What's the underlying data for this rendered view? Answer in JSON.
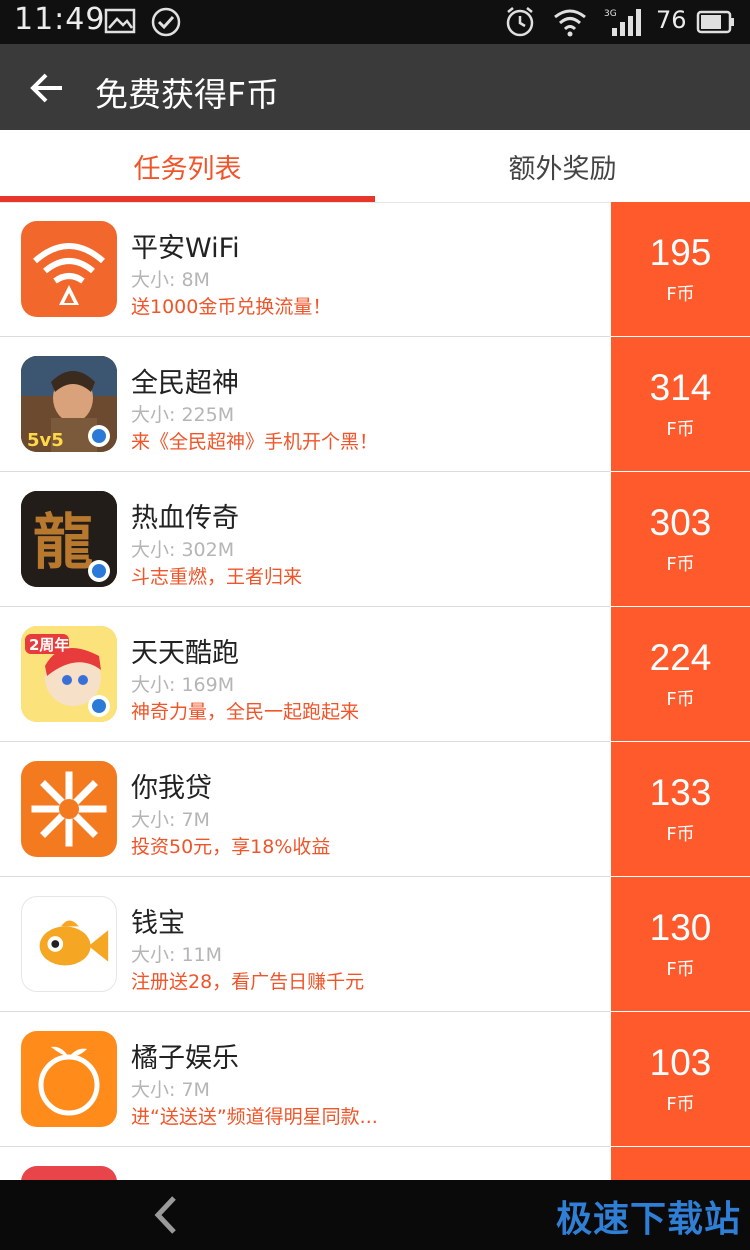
{
  "status_bar": {
    "time": "11:49",
    "battery_level": "76",
    "icons": [
      "image-icon",
      "check-circle-icon",
      "alarm-icon",
      "wifi-icon",
      "signal-3g-icon",
      "battery-icon"
    ]
  },
  "app_bar": {
    "title": "免费获得F币"
  },
  "tabs": [
    {
      "label": "任务列表",
      "active": true
    },
    {
      "label": "额外奖励",
      "active": false
    }
  ],
  "tasks": [
    {
      "name": "平安WiFi",
      "size": "大小: 8M",
      "desc": "送1000金币兑换流量！",
      "reward": "195",
      "unit": "F币",
      "icon": "wifi-app-icon"
    },
    {
      "name": "全民超神",
      "size": "大小: 225M",
      "desc": "来《全民超神》手机开个黑！",
      "reward": "314",
      "unit": "F币",
      "icon": "game-hero-icon"
    },
    {
      "name": "热血传奇",
      "size": "大小: 302M",
      "desc": "斗志重燃，王者归来",
      "reward": "303",
      "unit": "F币",
      "icon": "dragon-game-icon"
    },
    {
      "name": "天天酷跑",
      "size": "大小: 169M",
      "desc": "神奇力量，全民一起跑起来",
      "reward": "224",
      "unit": "F币",
      "icon": "runner-game-icon"
    },
    {
      "name": "你我贷",
      "size": "大小: 7M",
      "desc": "投资50元，享18%收益",
      "reward": "133",
      "unit": "F币",
      "icon": "loan-app-icon"
    },
    {
      "name": "钱宝",
      "size": "大小: 11M",
      "desc": "注册送28，看广告日赚千元",
      "reward": "130",
      "unit": "F币",
      "icon": "fish-app-icon"
    },
    {
      "name": "橘子娱乐",
      "size": "大小: 7M",
      "desc": "进“送送送”频道得明星同款...",
      "reward": "103",
      "unit": "F币",
      "icon": "orange-app-icon"
    }
  ],
  "nav_bar": {
    "watermark": "极速下载站"
  },
  "colors": {
    "accent": "#f0552a",
    "reward_bg": "#ff5a2c",
    "title_bar": "#3a3a3a"
  }
}
